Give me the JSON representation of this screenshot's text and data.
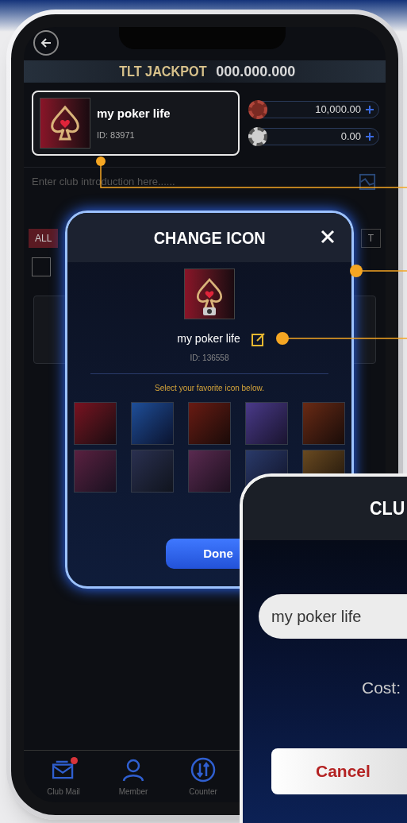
{
  "jackpot": {
    "label": "TLT JACKPOT",
    "amount": "000.000.000"
  },
  "club": {
    "name": "my poker life",
    "id": "ID: 83971"
  },
  "balances": [
    {
      "kind": "gold",
      "amount": "10,000.00"
    },
    {
      "kind": "silver",
      "amount": "0.00"
    }
  ],
  "introduction": {
    "placeholder": "Enter club introduction here......"
  },
  "filter_tabs": [
    {
      "label": "ALL",
      "selected": true
    },
    {
      "label": "T",
      "selected": false
    }
  ],
  "select_all": {
    "checked": false
  },
  "bottom_nav": [
    {
      "kind": "mail",
      "label": "Club Mail",
      "badge": true
    },
    {
      "kind": "member",
      "label": "Member",
      "badge": false
    },
    {
      "kind": "counter",
      "label": "Counter",
      "badge": false
    }
  ],
  "change_icon_dialog": {
    "title": "CHANGE ICON",
    "name": "my poker life",
    "id": "ID: 136558",
    "hint": "Select your favorite icon below.",
    "done": "Done"
  },
  "club_name_dialog": {
    "title": "CLU",
    "value": "my poker life",
    "cost_label": "Cost:",
    "cancel": "Cancel"
  }
}
